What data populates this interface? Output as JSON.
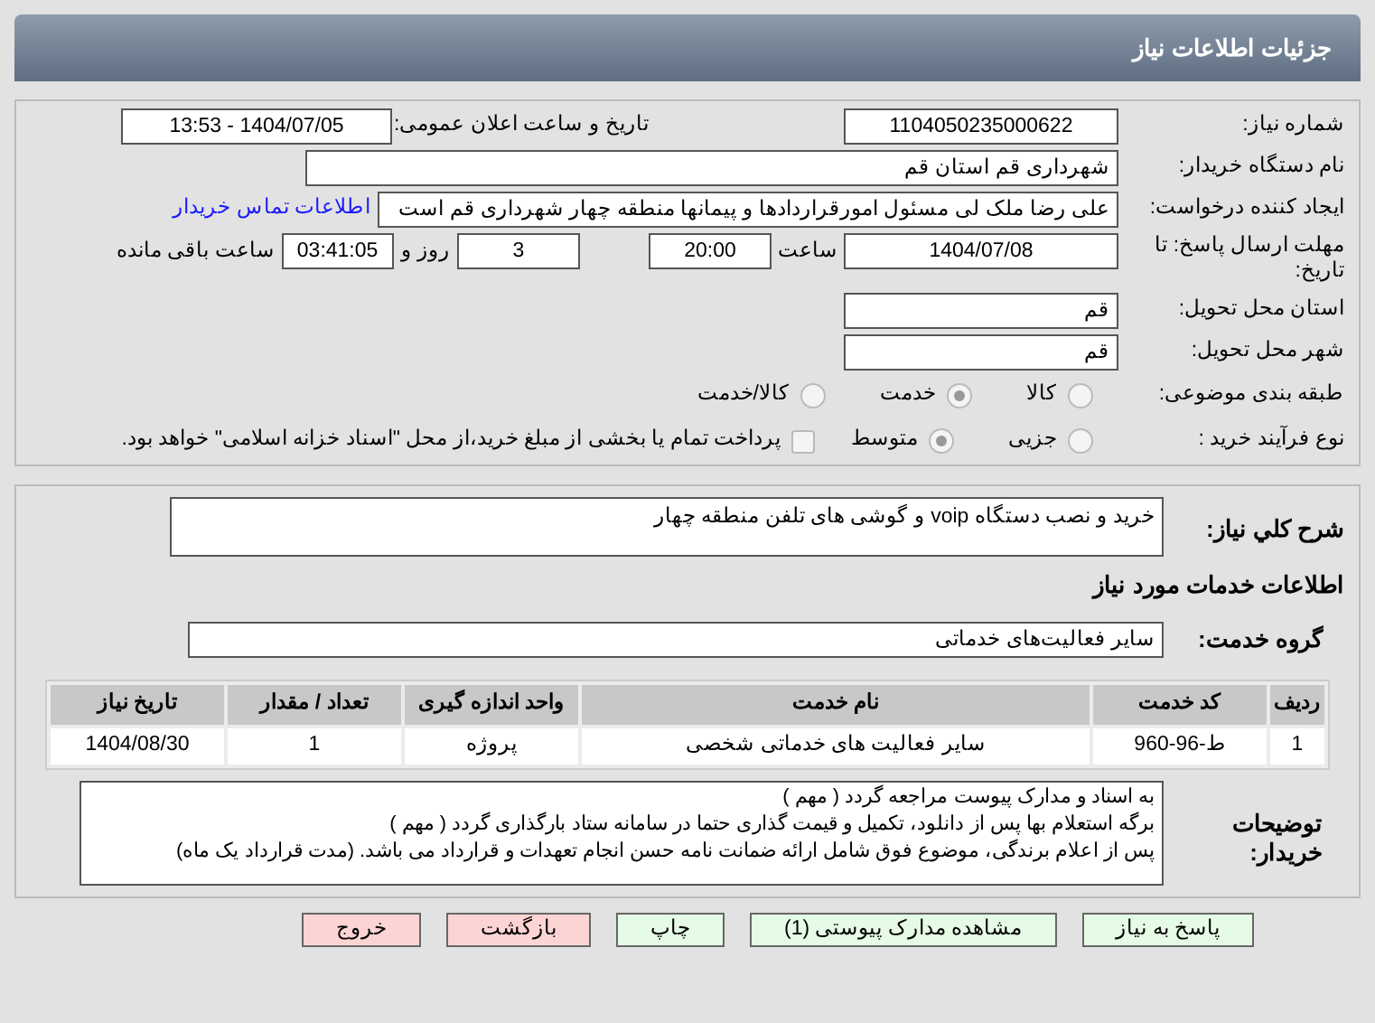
{
  "header": {
    "title": "جزئیات اطلاعات نیاز"
  },
  "need_number": {
    "label": "شماره نیاز:",
    "value": "1104050235000622"
  },
  "announce": {
    "label": "تاریخ و ساعت اعلان عمومی:",
    "value": "1404/07/05 - 13:53"
  },
  "buyer_org": {
    "label": "نام دستگاه خریدار:",
    "value": "شهرداری قم استان قم"
  },
  "requester": {
    "label": "ایجاد کننده درخواست:",
    "value": "علی رضا ملک لی مسئول امورقراردادها و پیمانها منطقه چهار  شهرداری قم است",
    "link": "اطلاعات تماس خریدار"
  },
  "deadline": {
    "label": "مهلت ارسال پاسخ: تا تاریخ:",
    "date": "1404/07/08",
    "time_label": "ساعت",
    "time": "20:00",
    "days": "3",
    "days_label": "روز و",
    "remaining": "03:41:05",
    "remaining_label": "ساعت باقی مانده"
  },
  "province": {
    "label": "استان محل تحویل:",
    "value": "قم"
  },
  "city": {
    "label": "شهر محل تحویل:",
    "value": "قم"
  },
  "category": {
    "label": "طبقه بندی موضوعی:",
    "options": [
      {
        "label": "کالا",
        "selected": false
      },
      {
        "label": "خدمت",
        "selected": true
      },
      {
        "label": "کالا/خدمت",
        "selected": false
      }
    ]
  },
  "process": {
    "label": "نوع فرآیند خرید :",
    "options": [
      {
        "label": "جزیی",
        "selected": false
      },
      {
        "label": "متوسط",
        "selected": true
      }
    ],
    "checkbox": {
      "label": "پرداخت تمام یا بخشی از مبلغ خرید،از محل \"اسناد خزانه اسلامی\" خواهد بود.",
      "checked": false
    }
  },
  "description": {
    "label": "شرح كلي نياز:",
    "value": "خرید و نصب دستگاه voip و گوشی های تلفن منطقه چهار"
  },
  "services_title": "اطلاعات خدمات مورد نیاز",
  "service_group": {
    "label": "گروه خدمت:",
    "value": "سایر فعالیت‌های خدماتی"
  },
  "table": {
    "columns": [
      "ردیف",
      "کد خدمت",
      "نام خدمت",
      "واحد اندازه گیری",
      "تعداد / مقدار",
      "تاریخ نیاز"
    ],
    "rows": [
      [
        "1",
        "ط-96-960",
        "سایر فعالیت های خدماتی شخصی",
        "پروژه",
        "1",
        "1404/08/30"
      ]
    ]
  },
  "buyer_notes": {
    "label": "توضیحات خریدار:",
    "lines": [
      "به اسناد و مدارک پیوست مراجعه گردد ( مهم )",
      "برگه استعلام بها پس از دانلود، تکمیل و قیمت گذاری حتما در سامانه ستاد بارگذاری گردد ( مهم )",
      "پس از اعلام برندگی، موضوع فوق شامل ارائه ضمانت نامه حسن انجام تعهدات و قرارداد می باشد. (مدت قرارداد یک ماه)"
    ]
  },
  "buttons": [
    {
      "label": "پاسخ به نیاز",
      "kind": "green"
    },
    {
      "label": "مشاهده مدارک پیوستی (1)",
      "kind": "green"
    },
    {
      "label": "چاپ",
      "kind": "green"
    },
    {
      "label": "بازگشت",
      "kind": "red"
    },
    {
      "label": "خروج",
      "kind": "red"
    }
  ]
}
